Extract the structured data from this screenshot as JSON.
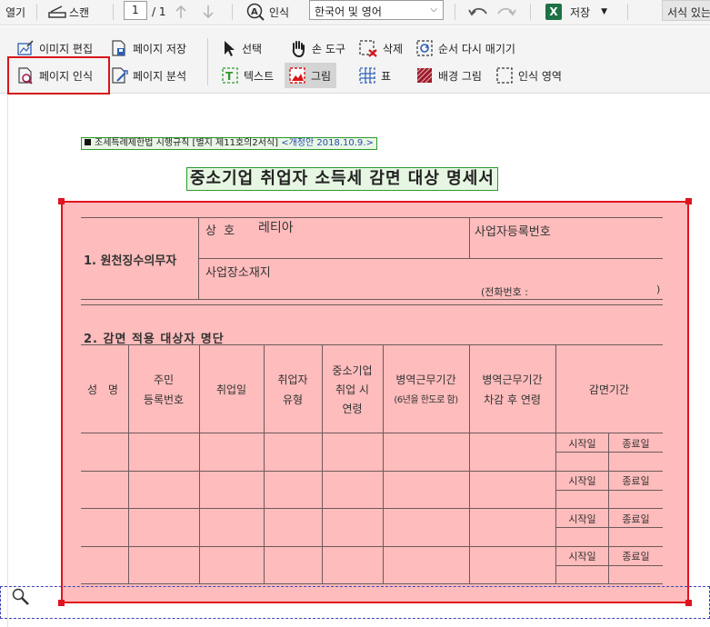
{
  "toolbar": {
    "open_label": "열기",
    "scan_label": "스캔",
    "page_current": "1",
    "page_total": "/ 1",
    "ocr_label": "인식",
    "language_value": "한국어 및 영어",
    "save_label": "저장",
    "formatted_text_label": "서식 있는 텍스트"
  },
  "tools": {
    "image_edit": "이미지 편집",
    "page_save": "페이지 저장",
    "select": "선택",
    "hand_tool": "손 도구",
    "delete": "삭제",
    "reorder": "순서 다시 매기기",
    "page_recognize": "페이지 인식",
    "page_analyze": "페이지 분석",
    "text": "텍스트",
    "picture": "그림",
    "table": "표",
    "background_picture": "배경 그림",
    "recognition_area": "인식 영역"
  },
  "document": {
    "form_header": "조세특례제한법 시행규칙 [별지 제11호의2서식]",
    "form_revision": "<개정안 2018.10.9.>",
    "title": "중소기업 취업자 소득세 감면 대상 명세서",
    "section1": "1. 원천징수의무자",
    "trade_name_label": "상 호",
    "trade_name_value": "레티아",
    "biz_reg_label": "사업자등록번호",
    "biz_address_label": "사업장소재지",
    "phone_label": "(전화번호 :",
    "phone_close": ")",
    "section2": "2. 감면 적용 대상자 명단",
    "col_name": "성 명",
    "col_resident_1": "주민",
    "col_resident_2": "등록번호",
    "col_hire_date": "취업일",
    "col_type_1": "취업자",
    "col_type_2": "유형",
    "col_sme_1": "중소기업",
    "col_sme_2": "취업 시",
    "col_sme_3": "연령",
    "col_military_1": "병역근무기간",
    "col_military_2": "(6년을 한도로 함)",
    "col_adjusted_1": "병역근무기간",
    "col_adjusted_2": "차감 후 연령",
    "col_period": "감면기간",
    "start_label": "시작일",
    "end_label": "종료일"
  }
}
